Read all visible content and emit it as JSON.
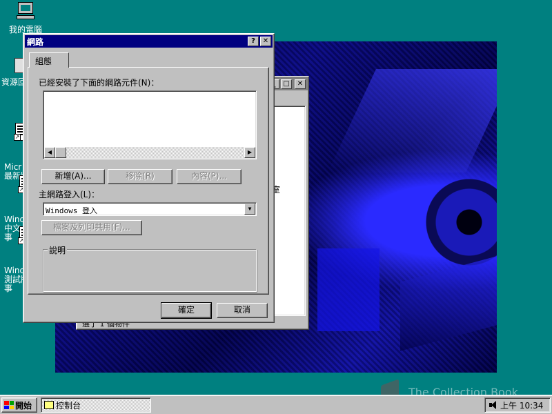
{
  "desktop": {
    "icons": [
      {
        "label": "我的電腦"
      },
      {
        "label": "資源回"
      },
      {
        "label": "Micr\n最新版"
      },
      {
        "label": "Windo\n中文\n事"
      },
      {
        "label": "Windo\n測試版\n事"
      }
    ]
  },
  "background_window": {
    "status": "選了 1 個物件",
    "peek_text": "室"
  },
  "dialog": {
    "title": "網路",
    "help_glyph": "?",
    "close_glyph": "✕",
    "tab_label": "組態",
    "components_label": "已經安裝了下面的網路元件(N)：",
    "add_button": "新增(A)...",
    "remove_button": "移除(R)",
    "properties_button": "內容(P)...",
    "primary_logon_label": "主網路登入(L)：",
    "primary_logon_value": "Windows 登入",
    "file_print_button": "檔案及列印共用(F)...",
    "description_label": "說明",
    "ok_button": "確定",
    "cancel_button": "取消"
  },
  "taskbar": {
    "start_label": "開始",
    "task_label": "控制台",
    "clock": "上午 10:34"
  },
  "watermark": {
    "text": "The Collection Book"
  },
  "colors": {
    "desktop": "#008080",
    "title_active": "#000080",
    "face": "#c0c0c0"
  }
}
